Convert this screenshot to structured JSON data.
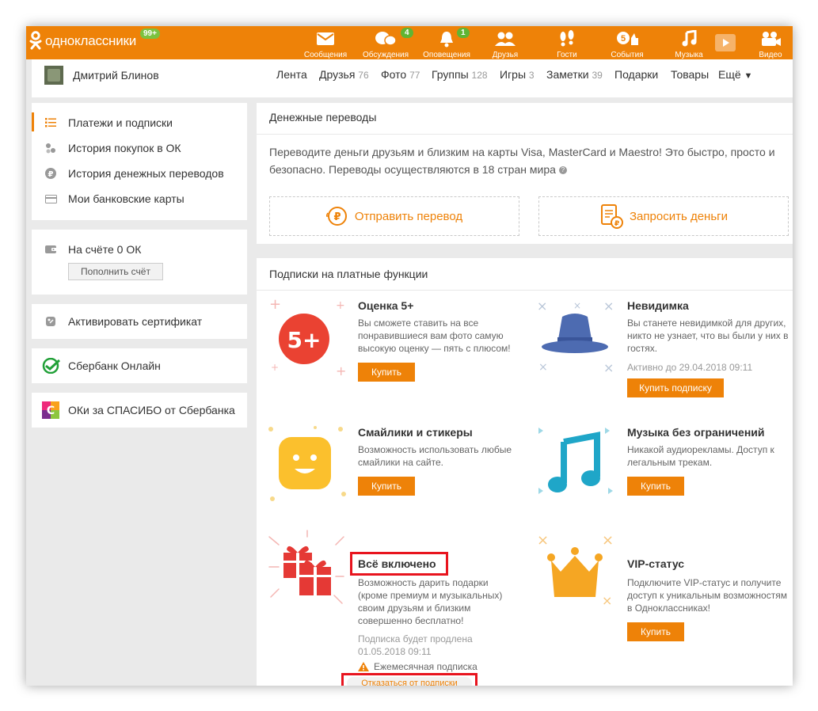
{
  "topbar": {
    "logo_text": "одноклассники",
    "logo_badge": "99+",
    "nav": [
      {
        "label": "Сообщения",
        "icon": "envelope-icon"
      },
      {
        "label": "Обсуждения",
        "icon": "chat-bubbles-icon",
        "badge": "4"
      },
      {
        "label": "Оповещения",
        "icon": "bell-icon",
        "badge": "1"
      },
      {
        "label": "Друзья",
        "icon": "friends-icon"
      },
      {
        "label": "Гости",
        "icon": "footprints-icon"
      },
      {
        "label": "События",
        "icon": "events-icon",
        "icon_text": "5"
      },
      {
        "label": "Музыка",
        "icon": "music-note-icon"
      },
      {
        "label": "Видео",
        "icon": "video-camera-icon"
      }
    ],
    "colors": {
      "brand": "#ee8208",
      "badge": "#5fb533"
    }
  },
  "profile": {
    "name": "Дмитрий Блинов",
    "nav": [
      {
        "label": "Лента",
        "count": ""
      },
      {
        "label": "Друзья",
        "count": "76"
      },
      {
        "label": "Фото",
        "count": "77"
      },
      {
        "label": "Группы",
        "count": "128"
      },
      {
        "label": "Игры",
        "count": "3"
      },
      {
        "label": "Заметки",
        "count": "39"
      },
      {
        "label": "Подарки",
        "count": ""
      },
      {
        "label": "Товары",
        "count": ""
      },
      {
        "label": "Ещё",
        "count": "",
        "arrow": "▼"
      }
    ]
  },
  "sidebar": {
    "menu": [
      {
        "label": "Платежи и подписки",
        "icon": "list-icon",
        "active": true
      },
      {
        "label": "История покупок в ОК",
        "icon": "coins-icon"
      },
      {
        "label": "История денежных переводов",
        "icon": "ruble-coin-icon"
      },
      {
        "label": "Мои банковские карты",
        "icon": "bank-card-icon"
      }
    ],
    "balance": {
      "label": "На счёте 0 ОК",
      "button": "Пополнить счёт"
    },
    "certificate": "Активировать сертификат",
    "sberbank": "Сбербанк Онлайн",
    "spasibo": "ОКи за СПАСИБО от Сбербанка"
  },
  "transfers": {
    "title": "Денежные переводы",
    "description": "Переводите деньги друзьям и близким на карты Visa, MasterCard и Maestro! Это быстро, просто и безопасно. Переводы осуществляются в 18 стран мира",
    "help": "?",
    "send": "Отправить перевод",
    "request": "Запросить деньги"
  },
  "subscriptions": {
    "title": "Подписки на платные функции",
    "items": [
      {
        "title": "Оценка 5+",
        "desc": "Вы сможете ставить на все понравившиеся вам фото самую высокую оценку — пять с плюсом!",
        "button": "Купить",
        "badge": "5+"
      },
      {
        "title": "Невидимка",
        "desc": "Вы станете невидимкой для других, никто не узнает, что вы были у них в гостях.",
        "note": "Активно до 29.04.2018 09:11",
        "button": "Купить подписку"
      },
      {
        "title": "Смайлики и стикеры",
        "desc": "Возможность использовать любые смайлики на сайте.",
        "button": "Купить"
      },
      {
        "title": "Музыка без ограничений",
        "desc": "Никакой аудиорекламы. Доступ к легальным трекам.",
        "button": "Купить"
      },
      {
        "title": "Всё включено",
        "desc": "Возможность дарить подарки (кроме премиум и музыкальных) своим друзьям и близким совершенно бесплатно!",
        "note": "Подписка будет продлена 01.05.2018 09:11",
        "warning": "Ежемесячная подписка",
        "cancel": "Отказаться от подписки"
      },
      {
        "title": "VIP-статус",
        "desc": "Подключите VIP-статус и получите доступ к уникальным возможностям в Одноклассниках!",
        "button": "Купить"
      }
    ]
  }
}
